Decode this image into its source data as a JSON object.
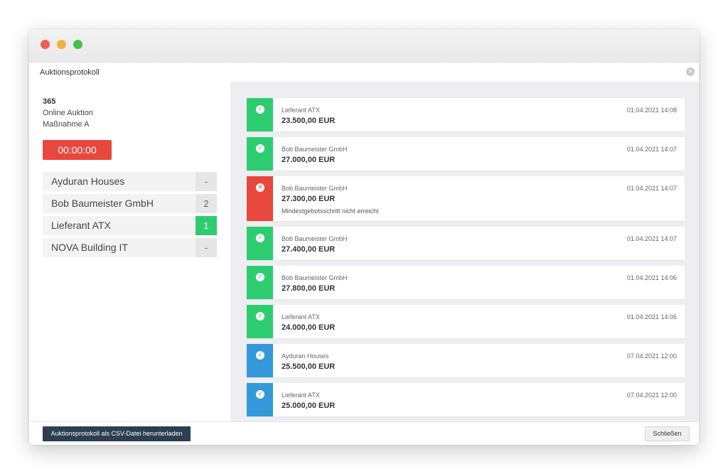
{
  "dialog": {
    "title": "Auktionsprotokoll",
    "close_icon": "×"
  },
  "auction": {
    "id": "365",
    "type": "Online Auktion",
    "measure": "Maßnahme A",
    "timer": "00:00:00"
  },
  "bidders": [
    {
      "name": "Ayduran Houses",
      "rank": "-"
    },
    {
      "name": "Bob Baumeister GmbH",
      "rank": "2"
    },
    {
      "name": "Lieferant ATX",
      "rank": "1"
    },
    {
      "name": "NOVA Building IT",
      "rank": "-"
    }
  ],
  "log": [
    {
      "bidder": "Lieferant ATX",
      "amount": "23.500,00 EUR",
      "note": "",
      "timestamp": "01.04.2021 14:08",
      "status": "accepted",
      "color": "#2ecc71",
      "icon": "✓"
    },
    {
      "bidder": "Bob Baumeister GmbH",
      "amount": "27.000,00 EUR",
      "note": "",
      "timestamp": "01.04.2021 14:07",
      "status": "accepted",
      "color": "#2ecc71",
      "icon": "✓"
    },
    {
      "bidder": "Bob Baumeister GmbH",
      "amount": "27.300,00 EUR",
      "note": "Mindestgebotsschritt nicht erreicht",
      "timestamp": "01.04.2021 14:07",
      "status": "rejected",
      "color": "#e8473d",
      "icon": "✕"
    },
    {
      "bidder": "Bob Baumeister GmbH",
      "amount": "27.400,00 EUR",
      "note": "",
      "timestamp": "01.04.2021 14:07",
      "status": "accepted",
      "color": "#2ecc71",
      "icon": "✓"
    },
    {
      "bidder": "Bob Baumeister GmbH",
      "amount": "27.800,00 EUR",
      "note": "",
      "timestamp": "01.04.2021 14:06",
      "status": "accepted",
      "color": "#2ecc71",
      "icon": "✓"
    },
    {
      "bidder": "Lieferant ATX",
      "amount": "24.000,00 EUR",
      "note": "",
      "timestamp": "01.04.2021 14:06",
      "status": "accepted",
      "color": "#2ecc71",
      "icon": "✓"
    },
    {
      "bidder": "Ayduran Houses",
      "amount": "25.500,00 EUR",
      "note": "",
      "timestamp": "07.04.2021 12:00",
      "status": "initial",
      "color": "#3498db",
      "icon": "✓"
    },
    {
      "bidder": "Lieferant ATX",
      "amount": "25.000,00 EUR",
      "note": "",
      "timestamp": "07.04.2021 12:00",
      "status": "initial",
      "color": "#3498db",
      "icon": "✓"
    }
  ],
  "footer": {
    "csv_label": "Auktionsprotokoll als CSV-Datei herunterladen",
    "close_label": "Schließen"
  }
}
